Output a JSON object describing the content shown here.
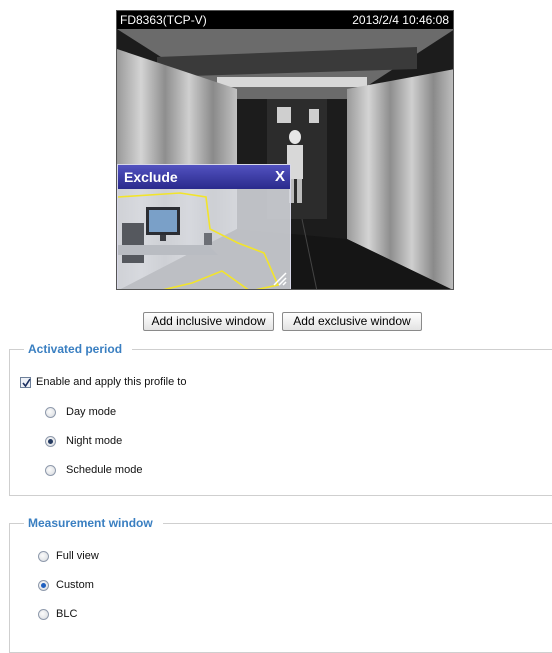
{
  "camera": {
    "name": "FD8363(TCP-V)",
    "timestamp": "2013/2/4 10:46:08"
  },
  "exclude_window": {
    "title": "Exclude",
    "close_label": "X"
  },
  "buttons": {
    "add_inclusive": "Add inclusive window",
    "add_exclusive": "Add exclusive window"
  },
  "activated_period": {
    "legend": "Activated period",
    "enable_label": "Enable and apply this profile to",
    "enable_checked": true,
    "options": [
      {
        "label": "Day mode",
        "selected": false
      },
      {
        "label": "Night mode",
        "selected": true
      },
      {
        "label": "Schedule mode",
        "selected": false
      }
    ]
  },
  "measurement_window": {
    "legend": "Measurement window",
    "options": [
      {
        "label": "Full view",
        "selected": false
      },
      {
        "label": "Custom",
        "selected": true
      },
      {
        "label": "BLC",
        "selected": false
      }
    ]
  },
  "colors": {
    "legend_text": "#3a7fc1",
    "exclude_title_bar": "#2a2a8c",
    "radio_selected": "#1f5fbf"
  }
}
